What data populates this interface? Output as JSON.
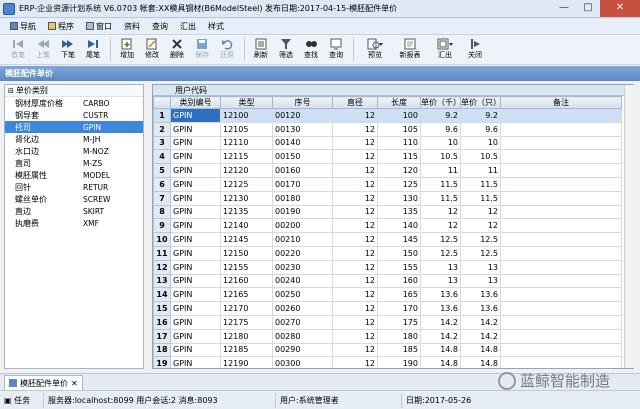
{
  "window": {
    "title": "ERP-企业资源计划系统 V6.0703 帐套:XX模具钢材(B6ModelSteel) 发布日期:2017-04-15-模胚配件单价",
    "controls": [
      "—",
      "□",
      "✕"
    ]
  },
  "menu": {
    "items": [
      "导航",
      "程序",
      "窗口",
      "资料",
      "查询",
      "汇出",
      "样式"
    ]
  },
  "toolbar": {
    "buttons": [
      {
        "label": "首笔",
        "icon": "first-icon",
        "enabled": false
      },
      {
        "label": "上笔",
        "icon": "prev-icon",
        "enabled": false
      },
      {
        "label": "下笔",
        "icon": "next-icon",
        "enabled": true
      },
      {
        "label": "尾笔",
        "icon": "last-icon",
        "enabled": true
      },
      {
        "label": "增加",
        "icon": "add-icon",
        "enabled": true
      },
      {
        "label": "修改",
        "icon": "edit-icon",
        "enabled": true
      },
      {
        "label": "删除",
        "icon": "delete-icon",
        "enabled": true
      },
      {
        "label": "保存",
        "icon": "save-icon",
        "enabled": false
      },
      {
        "label": "还原",
        "icon": "undo-icon",
        "enabled": false
      },
      {
        "label": "刷新",
        "icon": "refresh-icon",
        "enabled": true
      },
      {
        "label": "筛选",
        "icon": "filter-icon",
        "enabled": true
      },
      {
        "label": "查找",
        "icon": "find-icon",
        "enabled": true
      },
      {
        "label": "查询",
        "icon": "query-icon",
        "enabled": true
      },
      {
        "label": "预览",
        "icon": "preview-icon",
        "enabled": true
      },
      {
        "label": "新报表",
        "icon": "report-icon",
        "enabled": true
      },
      {
        "label": "汇出",
        "icon": "export-icon",
        "enabled": true
      },
      {
        "label": "关闭",
        "icon": "close-icon",
        "enabled": true
      }
    ]
  },
  "page_header": "模胚配件单价",
  "categories": {
    "header": "单价类别",
    "items": [
      {
        "name": "钢材厚度价格",
        "code": "CARBO"
      },
      {
        "name": "钢导套",
        "code": "CUSTR"
      },
      {
        "name": "托司",
        "code": "GPIN"
      },
      {
        "name": "肾化边",
        "code": "M-JH"
      },
      {
        "name": "水口边",
        "code": "M-NOZ"
      },
      {
        "name": "直司",
        "code": "M-ZS"
      },
      {
        "name": "模胚属性",
        "code": "MODEL"
      },
      {
        "name": "回针",
        "code": "RETUR"
      },
      {
        "name": "螺丝单价",
        "code": "SCREW"
      },
      {
        "name": "直边",
        "code": "SKIRT"
      },
      {
        "name": "执磨费",
        "code": "XMF"
      }
    ],
    "selected_index": 2
  },
  "grid": {
    "caption": "用户代码",
    "columns": [
      "",
      "类别编号",
      "类型",
      "序号",
      "直径",
      "长度",
      "单价（千）",
      "单价（只）",
      "备注"
    ],
    "rows": [
      [
        "1",
        "GPIN",
        "12100",
        "00120",
        "12",
        "100",
        "9.2",
        "9.2",
        ""
      ],
      [
        "2",
        "GPIN",
        "12105",
        "00130",
        "12",
        "105",
        "9.6",
        "9.6",
        ""
      ],
      [
        "3",
        "GPIN",
        "12110",
        "00140",
        "12",
        "110",
        "10",
        "10",
        ""
      ],
      [
        "4",
        "GPIN",
        "12115",
        "00150",
        "12",
        "115",
        "10.5",
        "10.5",
        ""
      ],
      [
        "5",
        "GPIN",
        "12120",
        "00160",
        "12",
        "120",
        "11",
        "11",
        ""
      ],
      [
        "6",
        "GPIN",
        "12125",
        "00170",
        "12",
        "125",
        "11.5",
        "11.5",
        ""
      ],
      [
        "7",
        "GPIN",
        "12130",
        "00180",
        "12",
        "130",
        "11.5",
        "11.5",
        ""
      ],
      [
        "8",
        "GPIN",
        "12135",
        "00190",
        "12",
        "135",
        "12",
        "12",
        ""
      ],
      [
        "9",
        "GPIN",
        "12140",
        "00200",
        "12",
        "140",
        "12",
        "12",
        ""
      ],
      [
        "10",
        "GPIN",
        "12145",
        "00210",
        "12",
        "145",
        "12.5",
        "12.5",
        ""
      ],
      [
        "11",
        "GPIN",
        "12150",
        "00220",
        "12",
        "150",
        "12.5",
        "12.5",
        ""
      ],
      [
        "12",
        "GPIN",
        "12155",
        "00230",
        "12",
        "155",
        "13",
        "13",
        ""
      ],
      [
        "13",
        "GPIN",
        "12160",
        "00240",
        "12",
        "160",
        "13",
        "13",
        ""
      ],
      [
        "14",
        "GPIN",
        "12165",
        "00250",
        "12",
        "165",
        "13.6",
        "13.6",
        ""
      ],
      [
        "15",
        "GPIN",
        "12170",
        "00260",
        "12",
        "170",
        "13.6",
        "13.6",
        ""
      ],
      [
        "16",
        "GPIN",
        "12175",
        "00270",
        "12",
        "175",
        "14.2",
        "14.2",
        ""
      ],
      [
        "17",
        "GPIN",
        "12180",
        "00280",
        "12",
        "180",
        "14.2",
        "14.2",
        ""
      ],
      [
        "18",
        "GPIN",
        "12185",
        "00290",
        "12",
        "185",
        "14.8",
        "14.8",
        ""
      ],
      [
        "19",
        "GPIN",
        "12190",
        "00300",
        "12",
        "190",
        "14.8",
        "14.8",
        ""
      ]
    ]
  },
  "tabs": [
    {
      "label": "模胚配件单价"
    }
  ],
  "status": {
    "tasks": "任务",
    "server": "服务器:localhost:8099 用户会话:2 消息:8093",
    "user": "用户:系统管理者",
    "date": "日期:2017-05-26"
  },
  "watermark": "蓝鲸智能制造",
  "colors": {
    "accent": "#3d86d9",
    "header": "#5b88c5"
  }
}
